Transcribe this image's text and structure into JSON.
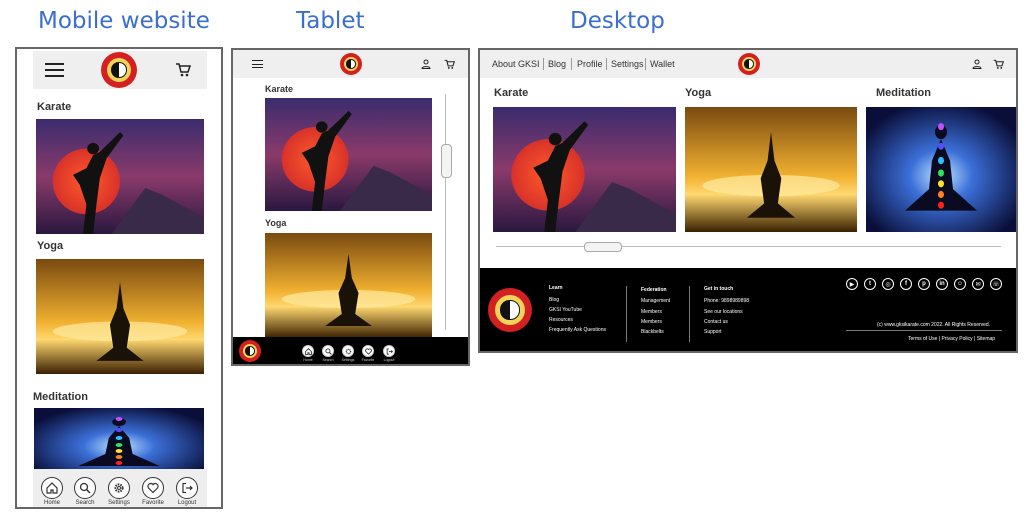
{
  "captions": {
    "mobile": "Mobile website",
    "tablet": "Tablet",
    "desktop": "Desktop"
  },
  "sections": {
    "karate": "Karate",
    "yoga": "Yoga",
    "meditation": "Meditation"
  },
  "mobile_nav": [
    {
      "label": "Home",
      "icon": "home-icon"
    },
    {
      "label": "Search",
      "icon": "search-icon"
    },
    {
      "label": "Settings",
      "icon": "settings-icon"
    },
    {
      "label": "Favorite",
      "icon": "heart-icon"
    },
    {
      "label": "Logout",
      "icon": "logout-icon"
    }
  ],
  "desktop_menu": [
    "About GKSI",
    "Blog",
    "Profile",
    "Settings",
    "Wallet"
  ],
  "footer": {
    "col1": {
      "title": "Learn",
      "items": [
        "Blog",
        "GKSI YouTube",
        "Resources",
        "Frequently Ask Questions"
      ]
    },
    "col2": {
      "title": "Federation",
      "items": [
        "Management",
        "Members",
        "Members",
        "Blackbelts"
      ]
    },
    "col3": {
      "title": "Get in touch",
      "items": [
        "Phone: 9898989898",
        "See our locations",
        "Contact us",
        "Support"
      ]
    },
    "copyright": "(c) www.gksikarate.com 2022. All Rights Reserved.",
    "legal": "Terms of Use | Privacy Policy | Sitemap",
    "social_icons": [
      "youtube-icon",
      "twitter-icon",
      "instagram-icon",
      "facebook-icon",
      "pinterest-icon",
      "linkedin-icon",
      "snapchat-icon",
      "email-icon",
      "phone-icon"
    ]
  },
  "colors": {
    "caption": "#3a6fd0",
    "footer_bg": "#000000",
    "header_bg": "#efefef",
    "logo_red": "#d32020"
  }
}
